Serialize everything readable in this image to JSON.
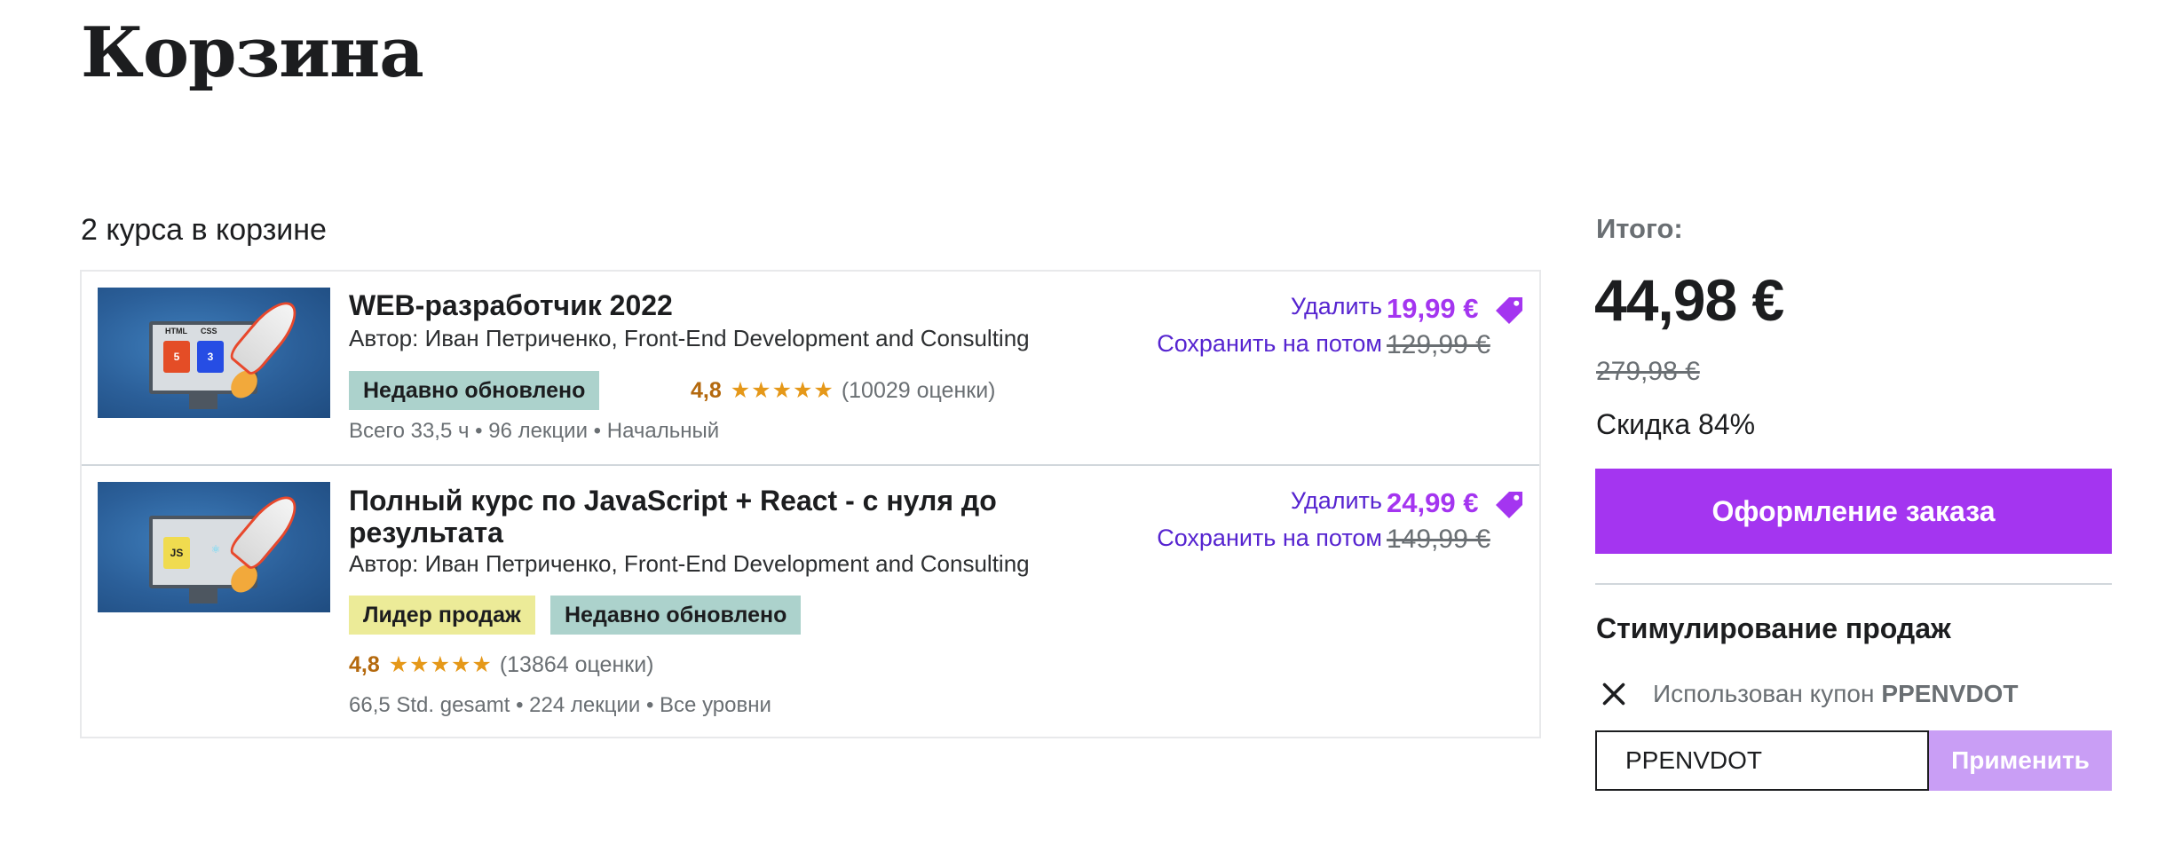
{
  "page": {
    "title": "Корзина",
    "count_text": "2 курса в корзине"
  },
  "items": [
    {
      "title": "WEB-разработчик 2022",
      "author": "Автор: Иван Петриченко, Front-End Development and Consulting",
      "badges": [
        "Недавно обновлено"
      ],
      "rating": "4,8",
      "stars": "★★★★★",
      "reviews": "(10029 оценки)",
      "meta": "Всего 33,5 ч • 96 лекции • Начальный",
      "remove_label": "Удалить",
      "save_label": "Сохранить на потом",
      "price": "19,99 €",
      "old_price": "129,99 €",
      "thumb_labels": [
        "HTML",
        "CSS"
      ],
      "thumb_badges": [
        "5",
        "3"
      ]
    },
    {
      "title": "Полный курс по JavaScript + React - с нуля до результата",
      "author": "Автор: Иван Петриченко, Front-End Development and Consulting",
      "badges": [
        "Лидер продаж",
        "Недавно обновлено"
      ],
      "rating": "4,8",
      "stars": "★★★★★",
      "reviews": "(13864 оценки)",
      "meta": "66,5 Std. gesamt • 224 лекции • Все уровни",
      "remove_label": "Удалить",
      "save_label": "Сохранить на потом",
      "price": "24,99 €",
      "old_price": "149,99 €",
      "thumb_badges": [
        "JS",
        "⚛"
      ]
    }
  ],
  "summary": {
    "total_label": "Итого:",
    "total_price": "44,98 €",
    "total_old": "279,98 €",
    "discount": "Скидка 84%",
    "checkout_label": "Оформление заказа"
  },
  "promo": {
    "title": "Стимулирование продаж",
    "applied_text": "Использован купон",
    "applied_code": "PPENVDOT",
    "input_value": "PPENVDOT",
    "apply_label": "Применить"
  },
  "colors": {
    "accent": "#a435f0",
    "link": "#5624d0",
    "rating": "#b4690e",
    "badge_updated": "#acd2cc",
    "badge_bestseller": "#eceb98"
  },
  "icons": [
    "price-tag-icon",
    "close-icon",
    "star-icon"
  ]
}
